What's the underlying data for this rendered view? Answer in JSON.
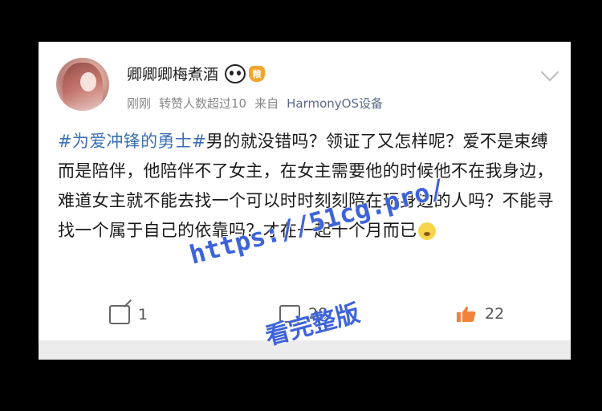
{
  "user": {
    "name": "卿卿卿梅煮酒",
    "badge_text": "粮"
  },
  "meta": {
    "time": "刚刚",
    "reposts_note": "转赞人数超过10",
    "source_prefix": "来自",
    "source": "HarmonyOS设备"
  },
  "post": {
    "tag": "#为爱冲锋的勇士#",
    "text": "男的就没错吗？领证了又怎样呢？爱不是束缚而是陪伴，他陪伴不了女主，在女主需要他的时候他不在我身边，难道女主就不能去找一个可以时时刻刻陪在玩身边的人吗？不能寻找一个属于自己的依靠吗？才在一起十个月而已"
  },
  "actions": {
    "repost_count": "1",
    "comment_count": "28",
    "like_count": "22"
  },
  "watermark": {
    "line1": "https://51cg.pro/",
    "line2": "看完整版"
  },
  "colors": {
    "tag": "#3b6fb6",
    "like": "#f0823a",
    "watermark": "#3e63d9"
  }
}
